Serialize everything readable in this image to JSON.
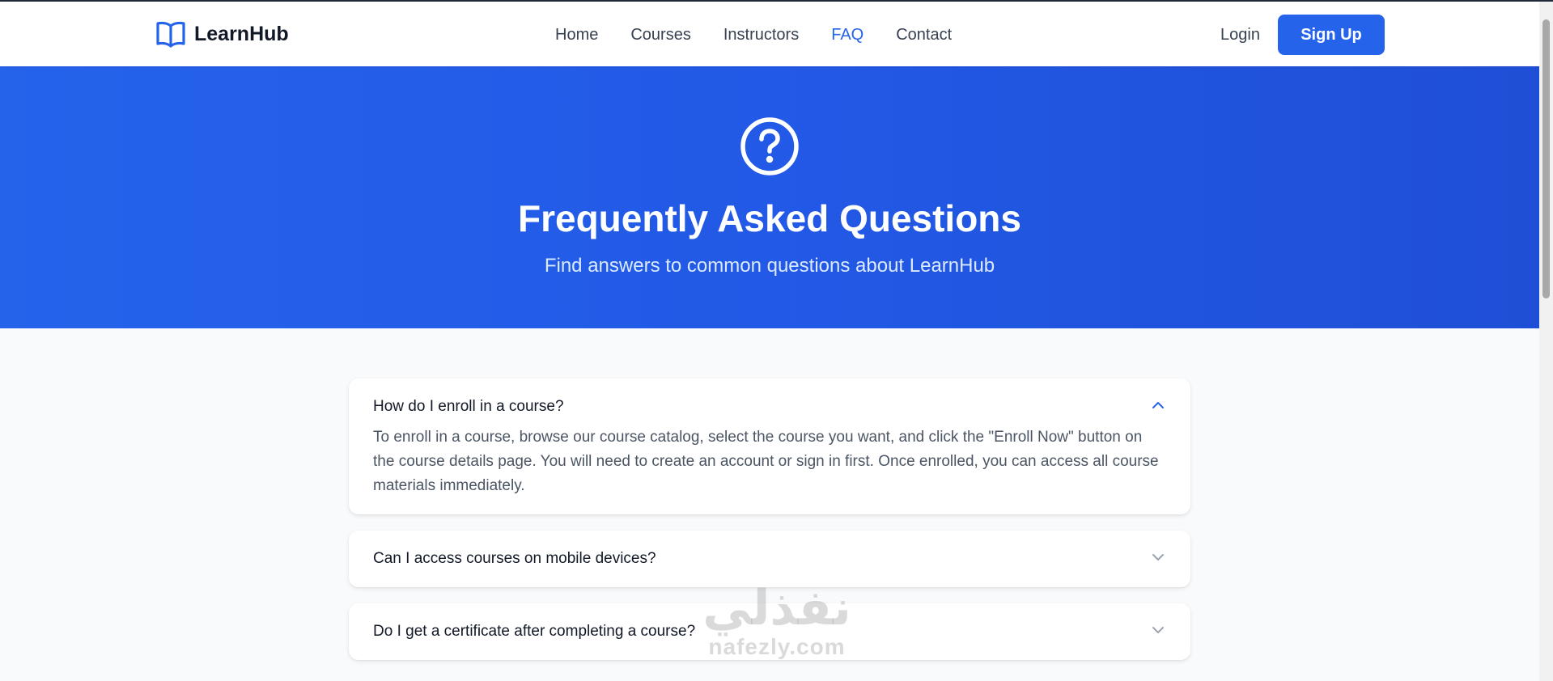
{
  "brand": {
    "name": "LearnHub",
    "logo_icon": "open-book-icon",
    "color": "#2563eb"
  },
  "nav": {
    "links": [
      {
        "label": "Home",
        "active": false
      },
      {
        "label": "Courses",
        "active": false
      },
      {
        "label": "Instructors",
        "active": false
      },
      {
        "label": "FAQ",
        "active": true
      },
      {
        "label": "Contact",
        "active": false
      }
    ],
    "login_label": "Login",
    "signup_label": "Sign Up"
  },
  "hero": {
    "icon": "question-circle-icon",
    "title": "Frequently Asked Questions",
    "subtitle": "Find answers to common questions about LearnHub",
    "color": "#2563eb"
  },
  "faq": {
    "items": [
      {
        "question": "How do I enroll in a course?",
        "answer": "To enroll in a course, browse our course catalog, select the course you want, and click the \"Enroll Now\" button on the course details page. You will need to create an account or sign in first. Once enrolled, you can access all course materials immediately.",
        "expanded": true,
        "icon": "chevron-up-icon"
      },
      {
        "question": "Can I access courses on mobile devices?",
        "expanded": false,
        "icon": "chevron-down-icon"
      },
      {
        "question": "Do I get a certificate after completing a course?",
        "expanded": false,
        "icon": "chevron-down-icon"
      }
    ]
  },
  "watermark": {
    "arabic": "نفذلي",
    "latin": "nafezly.com"
  }
}
